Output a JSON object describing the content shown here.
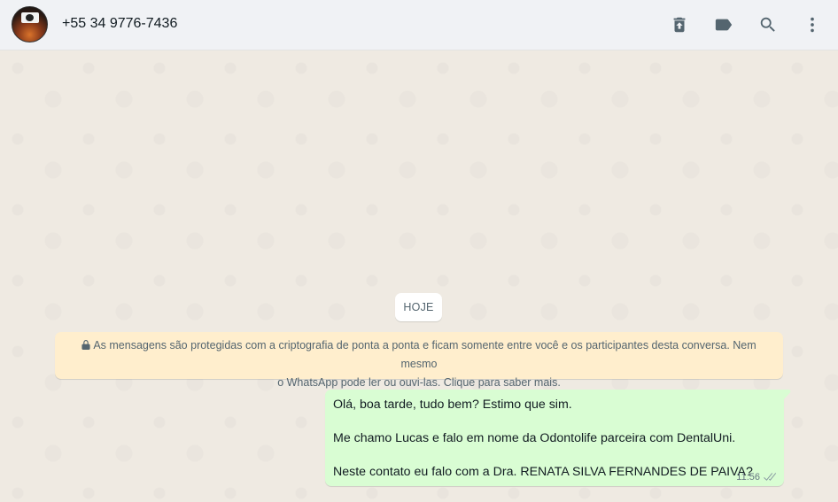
{
  "header": {
    "contact_name": "+55 34 9776-7436",
    "icons": [
      "delete-icon",
      "label-icon",
      "search-icon",
      "menu-icon"
    ]
  },
  "chat": {
    "date_chip": "HOJE",
    "e2e_notice": {
      "line1": "As mensagens são protegidas com a criptografia de ponta a ponta e ficam somente entre você e os participantes desta conversa. Nem mesmo",
      "line2": "o WhatsApp pode ler ou ouvi-las. Clique para saber mais."
    },
    "messages": [
      {
        "direction": "outgoing",
        "lines": [
          "Olá, boa tarde, tudo bem? Estimo que sim.",
          "Me chamo Lucas e falo em nome da Odontolife parceira com DentalUni.",
          "Neste contato eu falo com a Dra. RENATA SILVA FERNANDES DE PAIVA?"
        ],
        "time": "11:56",
        "status": "delivered"
      }
    ]
  },
  "colors": {
    "header_bg": "#f0f2f5",
    "chat_bg": "#efeae2",
    "outgoing_bubble": "#d9fdd3",
    "notice_bg": "#ffeecd"
  }
}
